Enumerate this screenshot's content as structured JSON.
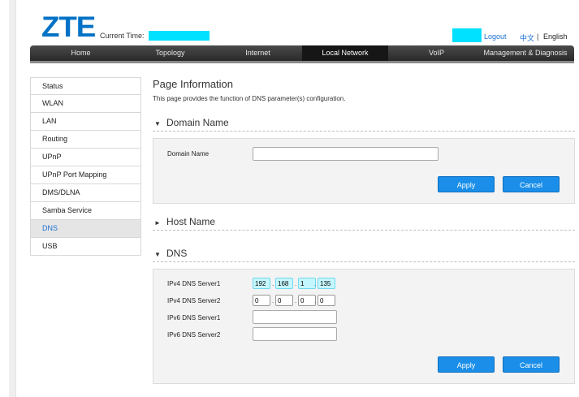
{
  "header": {
    "logo_text": "ZTE",
    "current_time_label": "Current Time:",
    "logout_label": "Logout",
    "lang_zh": "中文",
    "lang_sep": "|",
    "lang_en": "English"
  },
  "nav": {
    "items": [
      {
        "label": "Home"
      },
      {
        "label": "Topology"
      },
      {
        "label": "Internet"
      },
      {
        "label": "Local Network"
      },
      {
        "label": "VoIP"
      },
      {
        "label": "Management & Diagnosis"
      }
    ],
    "active": "Local Network"
  },
  "sidebar": {
    "items": [
      {
        "label": "Status"
      },
      {
        "label": "WLAN"
      },
      {
        "label": "LAN"
      },
      {
        "label": "Routing"
      },
      {
        "label": "UPnP"
      },
      {
        "label": "UPnP Port Mapping"
      },
      {
        "label": "DMS/DLNA"
      },
      {
        "label": "Samba Service"
      },
      {
        "label": "DNS"
      },
      {
        "label": "USB"
      }
    ],
    "active": "DNS"
  },
  "main": {
    "page_title": "Page Information",
    "page_desc": "This page provides the function of DNS parameter(s) configuration.",
    "domain_section": {
      "title": "Domain Name",
      "arrow": "▼",
      "domain_label": "Domain Name",
      "domain_value": "",
      "apply_label": "Apply",
      "cancel_label": "Cancel"
    },
    "host_section": {
      "title": "Host Name",
      "arrow": "►"
    },
    "dns_section": {
      "title": "DNS",
      "arrow": "▼",
      "ipv4_server1_label": "IPv4 DNS Server1",
      "ipv4_server1": [
        "192",
        "168",
        "1",
        "135"
      ],
      "ipv4_server2_label": "IPv4 DNS Server2",
      "ipv4_server2": [
        "0",
        "0",
        "0",
        "0"
      ],
      "ipv6_server1_label": "IPv6 DNS Server1",
      "ipv6_server1": "",
      "ipv6_server2_label": "IPv6 DNS Server2",
      "ipv6_server2": "",
      "apply_label": "Apply",
      "cancel_label": "Cancel"
    }
  },
  "colors": {
    "brand": "#0072c6",
    "link": "#1a6fd1",
    "button": "#1a8ee8",
    "redaction": "#00e0ff",
    "highlight_field": "#c5f7ff"
  }
}
